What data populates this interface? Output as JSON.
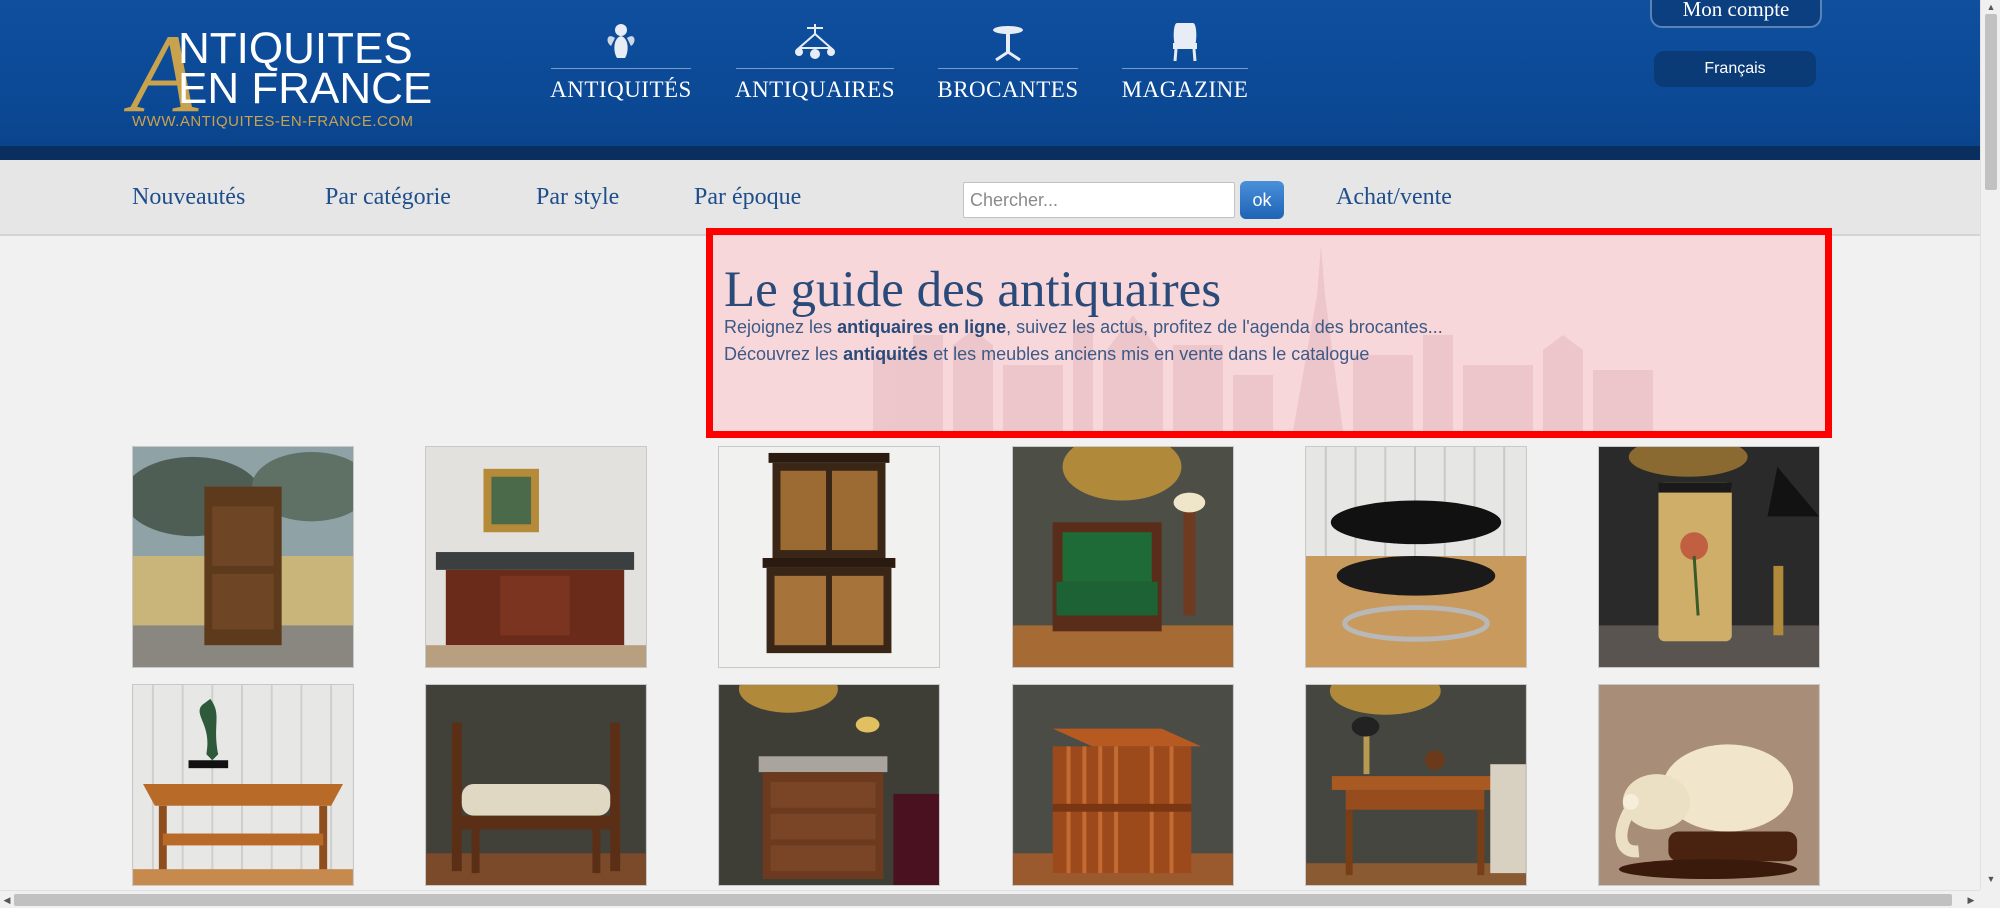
{
  "logo": {
    "letter": "A",
    "line1": "NTIQUITES",
    "line2": "EN FRANCE",
    "url": "WWW.ANTIQUITES-EN-FRANCE.COM"
  },
  "main_nav": [
    {
      "label": "ANTIQUITÉS",
      "icon": "cherub-icon"
    },
    {
      "label": "ANTIQUAIRES",
      "icon": "chandelier-icon"
    },
    {
      "label": "BROCANTES",
      "icon": "pedestal-table-icon"
    },
    {
      "label": "MAGAZINE",
      "icon": "armchair-icon"
    }
  ],
  "account": {
    "label": "Mon compte"
  },
  "language": {
    "label": "Français"
  },
  "sub_nav": [
    {
      "label": "Nouveautés"
    },
    {
      "label": "Par catégorie"
    },
    {
      "label": "Par style"
    },
    {
      "label": "Par époque"
    },
    {
      "label": "Achat/vente"
    }
  ],
  "search": {
    "placeholder": "Chercher...",
    "button": "ok"
  },
  "guide": {
    "title": "Le guide des antiquaires",
    "line1": {
      "prefix": "Rejoignez les ",
      "bold": "antiquaires en ligne",
      "suffix": ", suivez les actus, profitez de l'agenda des brocantes..."
    },
    "line2": {
      "prefix": "Découvrez les ",
      "bold": "antiquités",
      "suffix": " et les meubles anciens mis en vente dans le catalogue"
    }
  },
  "products": [
    {
      "name": "armoire-photo"
    },
    {
      "name": "marble-sideboard-photo"
    },
    {
      "name": "inlaid-cabinet-photo"
    },
    {
      "name": "green-armchair-photo"
    },
    {
      "name": "chrome-coffee-table-photo"
    },
    {
      "name": "lacquered-vase-photo"
    },
    {
      "name": "bronze-statue-table-photo"
    },
    {
      "name": "window-bench-photo"
    },
    {
      "name": "marble-commode-photo"
    },
    {
      "name": "revolving-bookcase-photo"
    },
    {
      "name": "writing-desk-photo"
    },
    {
      "name": "ivory-elephant-photo"
    }
  ],
  "colors": {
    "header_blue": "#0b4894",
    "nav_link": "#1f4e8c",
    "logo_gold": "#c9a24d",
    "highlight_border": "#ff0000"
  }
}
